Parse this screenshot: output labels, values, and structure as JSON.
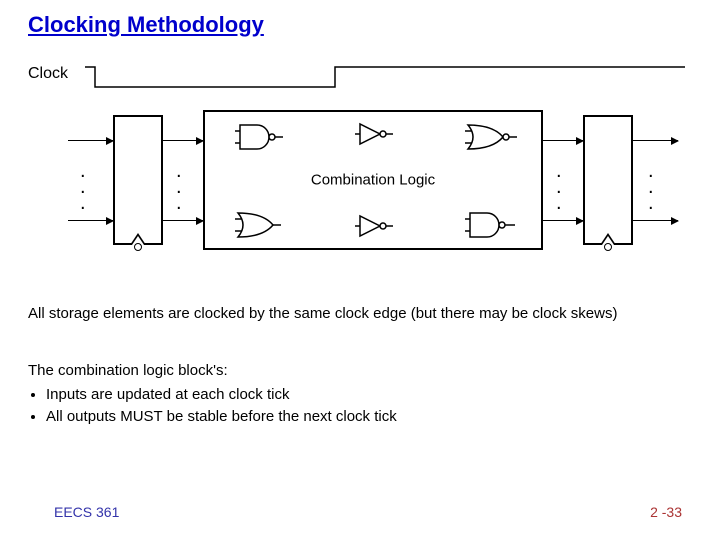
{
  "title": "Clocking Methodology",
  "clock_label": "Clock",
  "comb_label": "Combination Logic",
  "para1": "All storage elements are clocked by the same clock edge (but there may be clock skews)",
  "para2_intro": "The combination logic block's:",
  "para2_bullets": [
    "Inputs are updated at each clock tick",
    "All outputs MUST be stable before the next clock tick"
  ],
  "footer_left": "EECS 361",
  "footer_right": "2 -33"
}
